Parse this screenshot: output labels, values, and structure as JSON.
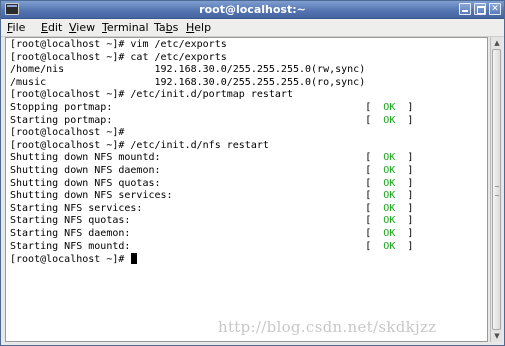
{
  "window": {
    "title": "root@localhost:~"
  },
  "menubar": {
    "items": [
      {
        "pre": "",
        "mnemonic": "F",
        "post": "ile"
      },
      {
        "pre": "",
        "mnemonic": "E",
        "post": "dit"
      },
      {
        "pre": "",
        "mnemonic": "V",
        "post": "iew"
      },
      {
        "pre": "",
        "mnemonic": "T",
        "post": "erminal"
      },
      {
        "pre": "Ta",
        "mnemonic": "b",
        "post": "s"
      },
      {
        "pre": "",
        "mnemonic": "H",
        "post": "elp"
      }
    ]
  },
  "terminal": {
    "lines": [
      {
        "text": "[root@localhost ~]# vim /etc/exports",
        "status": ""
      },
      {
        "text": "[root@localhost ~]# cat /etc/exports",
        "status": ""
      },
      {
        "text": "/home/nis               192.168.30.0/255.255.255.0(rw,sync)",
        "status": ""
      },
      {
        "text": "/music                  192.168.30.0/255.255.255.0(ro,sync)",
        "status": ""
      },
      {
        "text": "[root@localhost ~]# /etc/init.d/portmap restart",
        "status": ""
      },
      {
        "text": "Stopping portmap:",
        "status": "OK"
      },
      {
        "text": "Starting portmap:",
        "status": "OK"
      },
      {
        "text": "[root@localhost ~]#",
        "status": ""
      },
      {
        "text": "[root@localhost ~]# /etc/init.d/nfs restart",
        "status": ""
      },
      {
        "text": "Shutting down NFS mountd:",
        "status": "OK"
      },
      {
        "text": "Shutting down NFS daemon:",
        "status": "OK"
      },
      {
        "text": "Shutting down NFS quotas:",
        "status": "OK"
      },
      {
        "text": "Shutting down NFS services:",
        "status": "OK"
      },
      {
        "text": "Starting NFS services:",
        "status": "OK"
      },
      {
        "text": "Starting NFS quotas:",
        "status": "OK"
      },
      {
        "text": "Starting NFS daemon:",
        "status": "OK"
      },
      {
        "text": "Starting NFS mountd:",
        "status": "OK"
      },
      {
        "text": "[root@localhost ~]# ",
        "status": "",
        "cursor": true
      }
    ]
  },
  "watermark": "http://blog.csdn.net/skdkjzz",
  "icons": {
    "app": "terminal-icon",
    "minimize": "minimize-icon",
    "maximize": "maximize-icon",
    "close": "close-icon"
  },
  "colors": {
    "titlebar": "#5676b2",
    "ok": "#1aa51a",
    "terminal_bg": "#ffffff"
  }
}
